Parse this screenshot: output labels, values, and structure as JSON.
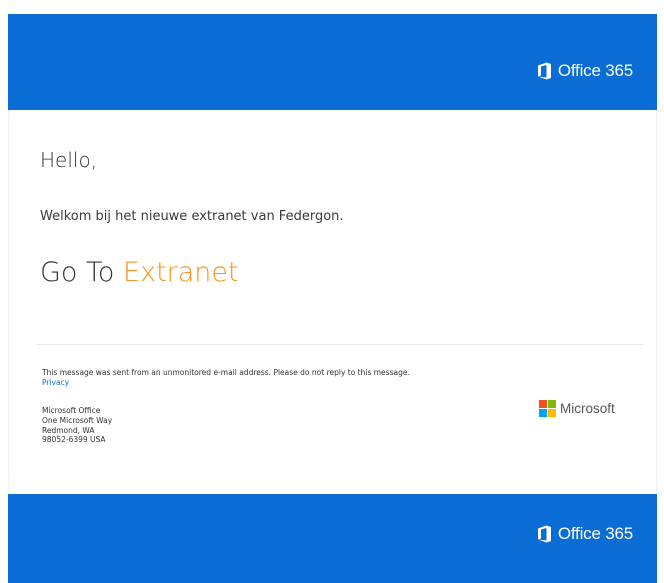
{
  "header": {
    "brand": "Office 365"
  },
  "body": {
    "greeting": "Hello,",
    "welcome": "Welkom bij het nieuwe extranet van Federgon.",
    "cta_prefix": "Go To ",
    "cta_link": "Extranet"
  },
  "footer": {
    "notice": "This message was sent from an unmonitored e-mail address. Please do not reply to this message.",
    "privacy": "Privacy",
    "address": [
      "Microsoft Office",
      "One Microsoft Way",
      "Redmond, WA",
      "98052-6399 USA"
    ],
    "microsoft_label": "Microsoft",
    "brand": "Office 365"
  },
  "colors": {
    "banner": "#0a6dd6",
    "accent": "#f7941d",
    "ms_red": "#f25022",
    "ms_green": "#7fba00",
    "ms_blue": "#00a4ef",
    "ms_yellow": "#ffb900"
  },
  "icons": {
    "office": "office-logo-icon",
    "microsoft": "microsoft-logo-icon"
  }
}
